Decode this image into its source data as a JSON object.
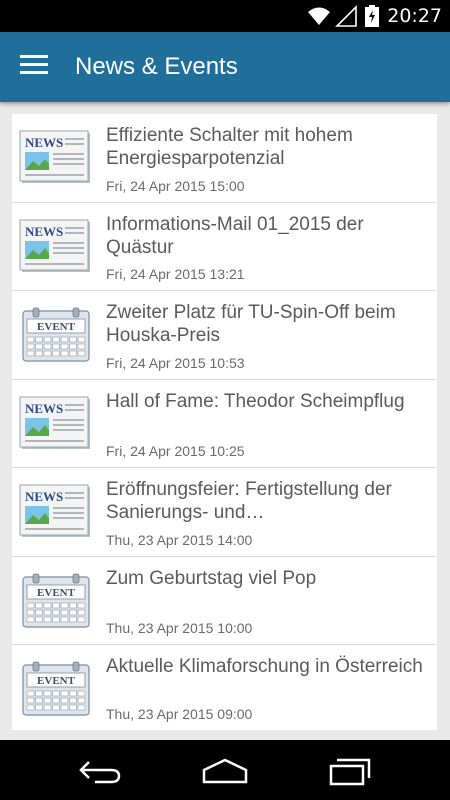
{
  "status": {
    "time": "20:27"
  },
  "appbar": {
    "title": "News & Events"
  },
  "items": [
    {
      "type": "news",
      "title": "Effiziente Schalter mit hohem Energiesparpotenzial",
      "date": "Fri, 24 Apr 2015 15:00"
    },
    {
      "type": "news",
      "title": "Informations-Mail 01_2015 der Quästur",
      "date": "Fri, 24 Apr 2015 13:21"
    },
    {
      "type": "event",
      "title": "Zweiter Platz für TU-Spin-Off beim Houska-Preis",
      "date": "Fri, 24 Apr 2015 10:53"
    },
    {
      "type": "news",
      "title": "Hall of Fame: Theodor Scheimpflug",
      "date": "Fri, 24 Apr 2015 10:25"
    },
    {
      "type": "news",
      "title": "Eröffnungsfeier: Fertigstellung der Sanierungs- und…",
      "date": "Thu, 23 Apr 2015 14:00"
    },
    {
      "type": "event",
      "title": "Zum Geburtstag viel Pop",
      "date": "Thu, 23 Apr 2015 10:00"
    },
    {
      "type": "event",
      "title": "Aktuelle Klimaforschung in Österreich",
      "date": "Thu, 23 Apr 2015 09:00"
    }
  ],
  "icons": {
    "news": {
      "label": "NEWS",
      "name": "newspaper-icon"
    },
    "event": {
      "label": "EVENT",
      "name": "calendar-event-icon"
    }
  }
}
